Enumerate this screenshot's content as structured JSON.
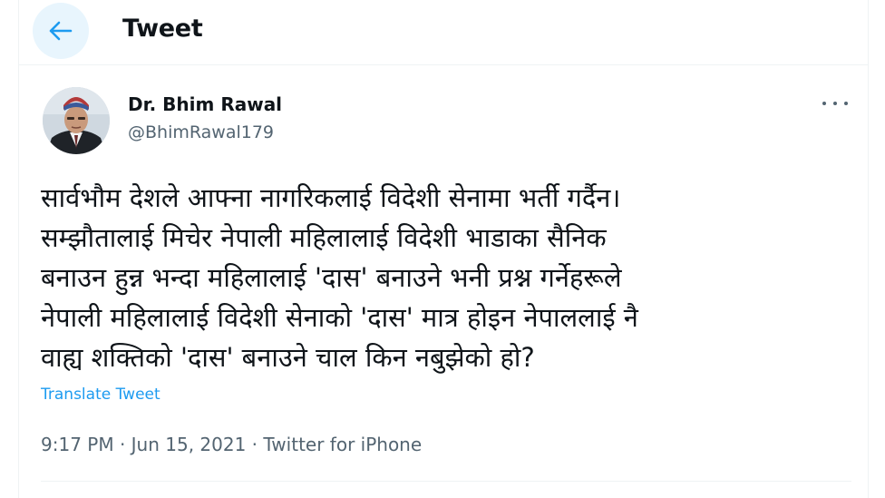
{
  "header": {
    "title": "Tweet",
    "back_icon": "arrow-left-icon"
  },
  "author": {
    "name": "Dr. Bhim Rawal",
    "handle": "@BhimRawal179",
    "more_icon": "more-horizontal-icon"
  },
  "tweet": {
    "text": "सार्वभौम देशले आफ्ना नागरिकलाई विदेशी सेनामा भर्ती गर्दैन।\nसम्झौतालाई मिचेर नेपाली महिलालाई विदेशी भाडाका सैनिक\nबनाउन हुन्न भन्दा महिलालाई 'दास' बनाउने भनी प्रश्न गर्नेहरूले\nनेपाली महिलालाई विदेशी सेनाको 'दास' मात्र होइन नेपाललाई नै\nवाह्य शक्तिको 'दास' बनाउने चाल किन नबुझेको हो?",
    "translate_label": "Translate Tweet",
    "meta": "9:17 PM · Jun 15, 2021 · Twitter for iPhone"
  },
  "colors": {
    "accent": "#1d9bf0",
    "back_button_bg": "#e8f5fd",
    "secondary_text": "#536471",
    "divider": "#eff3f4"
  }
}
